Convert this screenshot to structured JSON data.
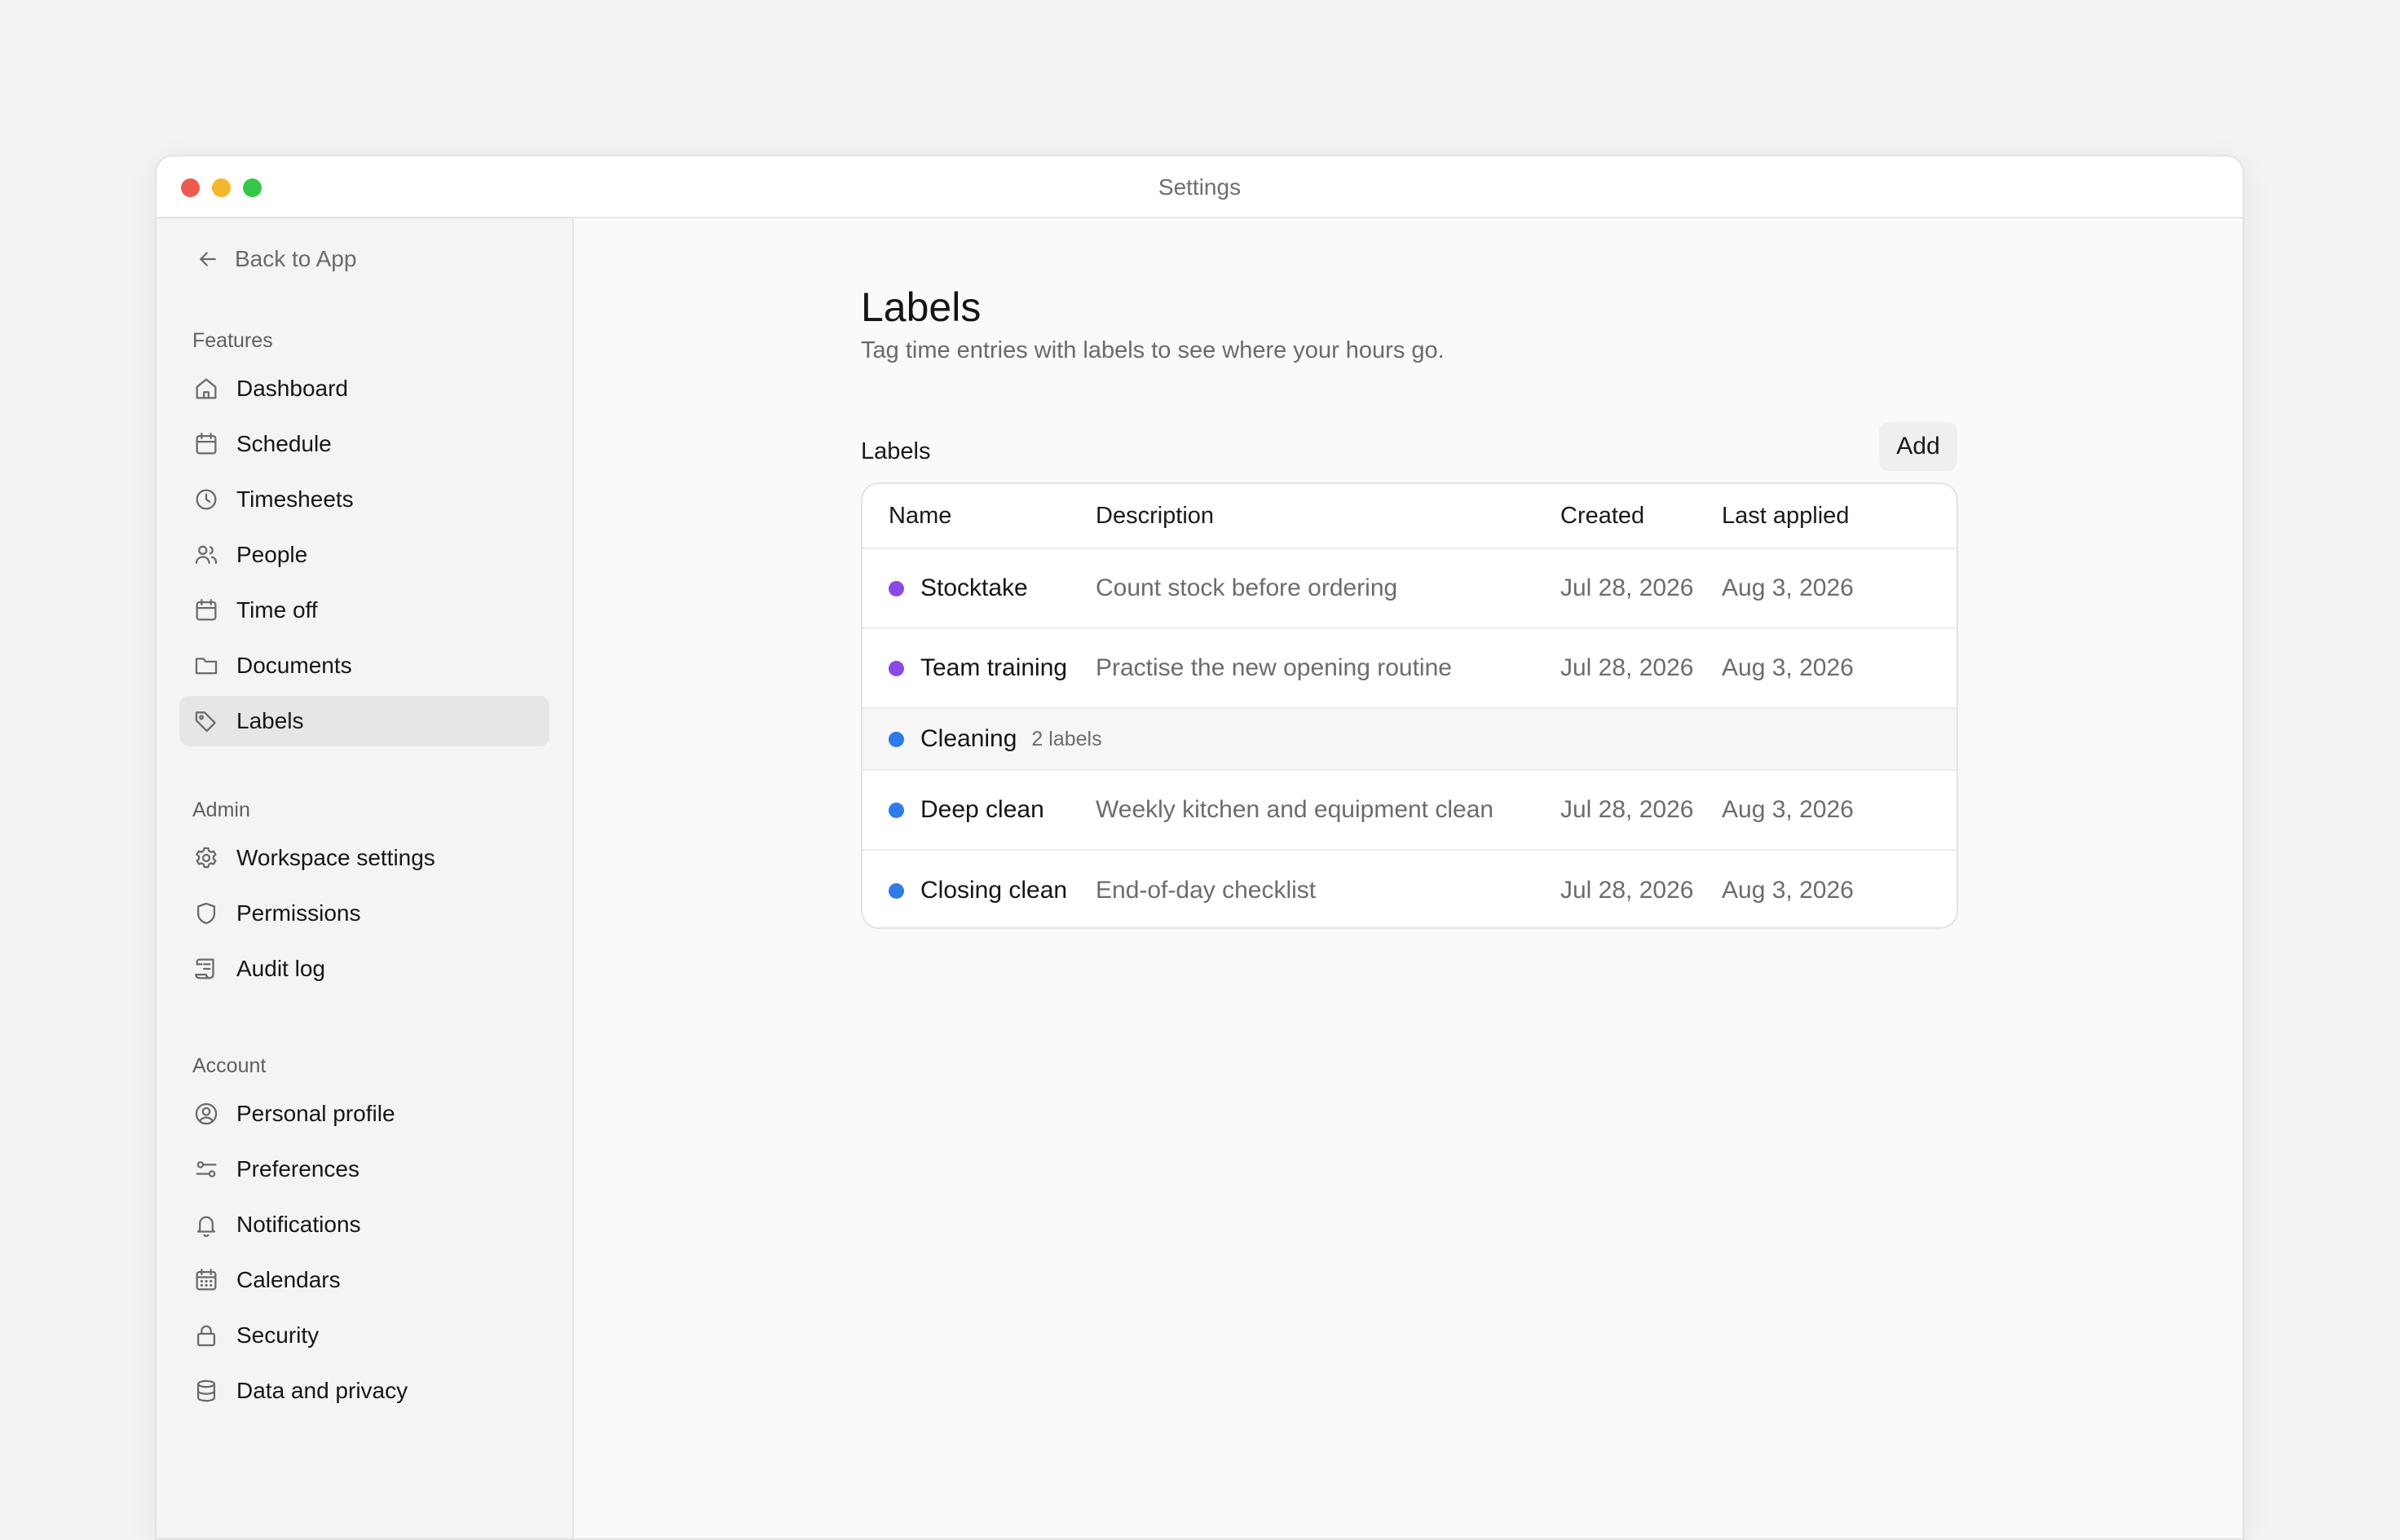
{
  "window": {
    "title": "Settings"
  },
  "sidebar": {
    "back_label": "Back to App",
    "sections": [
      {
        "title": "Features",
        "items": [
          {
            "label": "Dashboard",
            "icon": "home-icon"
          },
          {
            "label": "Schedule",
            "icon": "calendar-icon"
          },
          {
            "label": "Timesheets",
            "icon": "clock-icon"
          },
          {
            "label": "People",
            "icon": "users-icon"
          },
          {
            "label": "Time off",
            "icon": "calendar-icon"
          },
          {
            "label": "Documents",
            "icon": "folder-icon"
          },
          {
            "label": "Labels",
            "icon": "tag-icon",
            "active": true
          }
        ]
      },
      {
        "title": "Admin",
        "items": [
          {
            "label": "Workspace settings",
            "icon": "gear-icon"
          },
          {
            "label": "Permissions",
            "icon": "shield-icon"
          },
          {
            "label": "Audit log",
            "icon": "scroll-icon"
          }
        ]
      },
      {
        "title": "Account",
        "items": [
          {
            "label": "Personal profile",
            "icon": "user-circle-icon"
          },
          {
            "label": "Preferences",
            "icon": "sliders-icon"
          },
          {
            "label": "Notifications",
            "icon": "bell-icon"
          },
          {
            "label": "Calendars",
            "icon": "calendar-grid-icon"
          },
          {
            "label": "Security",
            "icon": "lock-icon"
          },
          {
            "label": "Data and privacy",
            "icon": "database-icon"
          }
        ]
      }
    ]
  },
  "main": {
    "title": "Labels",
    "subtitle": "Tag time entries with labels to see where your hours go.",
    "section_label": "Labels",
    "add_label": "Add",
    "table": {
      "columns": [
        "Name",
        "Description",
        "Created",
        "Last applied"
      ],
      "rows": [
        {
          "type": "label",
          "name": "Stocktake",
          "color": "#8b4ae8",
          "description": "Count stock before ordering",
          "created": "Jul 28, 2026",
          "last_applied": "Aug 3, 2026"
        },
        {
          "type": "label",
          "name": "Team training",
          "color": "#8b4ae8",
          "description": "Practise the new opening routine",
          "created": "Jul 28, 2026",
          "last_applied": "Aug 3, 2026"
        },
        {
          "type": "group",
          "name": "Cleaning",
          "color": "#2f7be8",
          "count": "2 labels"
        },
        {
          "type": "label",
          "name": "Deep clean",
          "color": "#2f7be8",
          "description": "Weekly kitchen and equipment clean",
          "created": "Jul 28, 2026",
          "last_applied": "Aug 3, 2026"
        },
        {
          "type": "label",
          "name": "Closing clean",
          "color": "#2f7be8",
          "description": "End-of-day checklist",
          "created": "Jul 28, 2026",
          "last_applied": "Aug 3, 2026"
        }
      ]
    }
  }
}
